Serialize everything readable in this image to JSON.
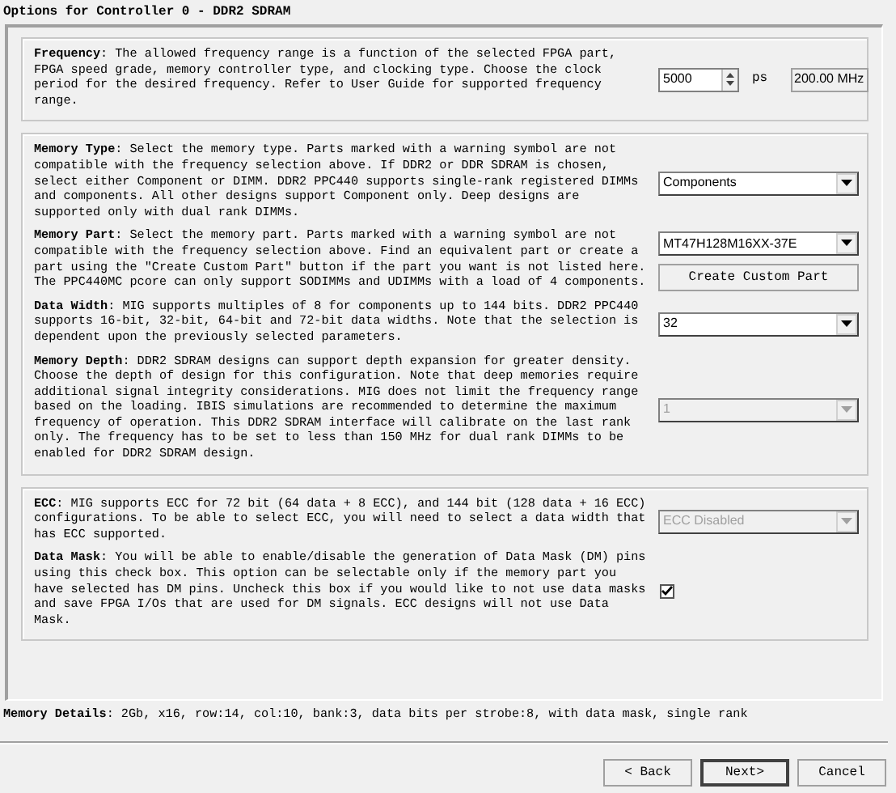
{
  "window": {
    "title": "Options for Controller 0 - DDR2 SDRAM"
  },
  "groups": [
    {
      "rows": [
        {
          "kind": "spinner",
          "text": "**Frequency**: The allowed frequency range is a function of the selected FPGA part, FPGA speed grade, memory controller type, and clocking type. Choose the clock period for the desired frequency. Refer to User Guide for supported frequency range.",
          "value": "5000",
          "unit": "ps",
          "readout": "200.00 MHz"
        }
      ]
    },
    {
      "rows": [
        {
          "kind": "select",
          "text": "**Memory Type**: Select the memory type. Parts marked with a warning symbol are not compatible with the frequency selection above. If DDR2 or DDR SDRAM is chosen, select either Component or DIMM. DDR2 PPC440 supports single-rank registered DIMMs and components. All other designs support Component only. Deep designs are supported only with dual rank DIMMs.",
          "value": "Components",
          "disabled": false
        },
        {
          "kind": "select_button",
          "text": "**Memory Part**: Select the memory part. Parts marked with a warning symbol are not compatible with the frequency selection above. Find an equivalent part or create a part using the \"Create Custom Part\" button if the part you want is not listed here. The PPC440MC pcore can only support SODIMMs and UDIMMs with a load of 4 components.",
          "value": "MT47H128M16XX-37E",
          "disabled": false,
          "button": "Create Custom Part"
        },
        {
          "kind": "select",
          "text": "**Data Width**: MIG supports multiples of 8 for components up to 144 bits. DDR2 PPC440 supports 16-bit, 32-bit, 64-bit and 72-bit data widths. Note that the selection is dependent upon the previously selected parameters.",
          "value": "32",
          "disabled": false
        },
        {
          "kind": "select",
          "text": "**Memory Depth**: DDR2 SDRAM designs can support depth expansion for greater density. Choose the depth of design for this configuration. Note that deep memories require additional signal integrity considerations. MIG does not limit the frequency range based on the loading. IBIS simulations are recommended to determine the maximum frequency of operation. This DDR2 SDRAM interface will calibrate on the last rank only. The frequency has to be set to less than 150 MHz for dual rank DIMMs to be enabled for DDR2 SDRAM design.",
          "value": "1",
          "disabled": true
        }
      ]
    },
    {
      "rows": [
        {
          "kind": "select",
          "text": "**ECC**: MIG supports ECC for 72 bit (64 data + 8 ECC), and 144 bit (128 data + 16 ECC) configurations. To be able to select ECC, you will need to select a data width that has ECC supported.",
          "value": "ECC Disabled",
          "disabled": true
        },
        {
          "kind": "checkbox",
          "text": "**Data Mask**: You will be able to enable/disable the generation of Data Mask (DM) pins using this check box. This option can be selectable only if the memory part you have selected has DM pins. Uncheck this box if you would like to not use data masks and save FPGA I/Os that are used for DM signals. ECC designs will not use Data Mask.",
          "checked": true
        }
      ]
    }
  ],
  "memory_details": "**Memory Details**: 2Gb, x16, row:14, col:10, bank:3, data bits per strobe:8, with data mask, single rank",
  "buttons": [
    {
      "label": "< Back",
      "default": false
    },
    {
      "label": "Next>",
      "default": true
    },
    {
      "label": "Cancel",
      "default": false
    }
  ]
}
